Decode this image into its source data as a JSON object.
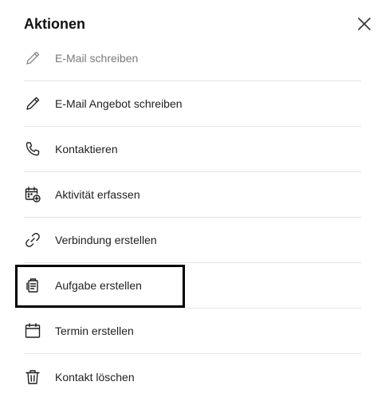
{
  "dialog": {
    "title": "Aktionen",
    "close_icon": "close-icon"
  },
  "menu": {
    "items": [
      {
        "label": "E-Mail schreiben",
        "icon": "pencil-icon",
        "state": "disabled"
      },
      {
        "label": "E-Mail Angebot schreiben",
        "icon": "pencil-icon"
      },
      {
        "label": "Kontaktieren",
        "icon": "phone-icon"
      },
      {
        "label": "Aktivität erfassen",
        "icon": "calendar-plus-icon"
      },
      {
        "label": "Verbindung erstellen",
        "icon": "link-icon"
      },
      {
        "label": "Aufgabe erstellen",
        "icon": "clipboard-icon",
        "highlighted": true
      },
      {
        "label": "Termin erstellen",
        "icon": "calendar-icon"
      },
      {
        "label": "Kontakt löschen",
        "icon": "trash-icon"
      }
    ]
  },
  "colors": {
    "text": "#1f1f1f",
    "muted_text": "#7a7a7a",
    "divider": "#e4e4e4",
    "highlight_border": "#000000"
  }
}
